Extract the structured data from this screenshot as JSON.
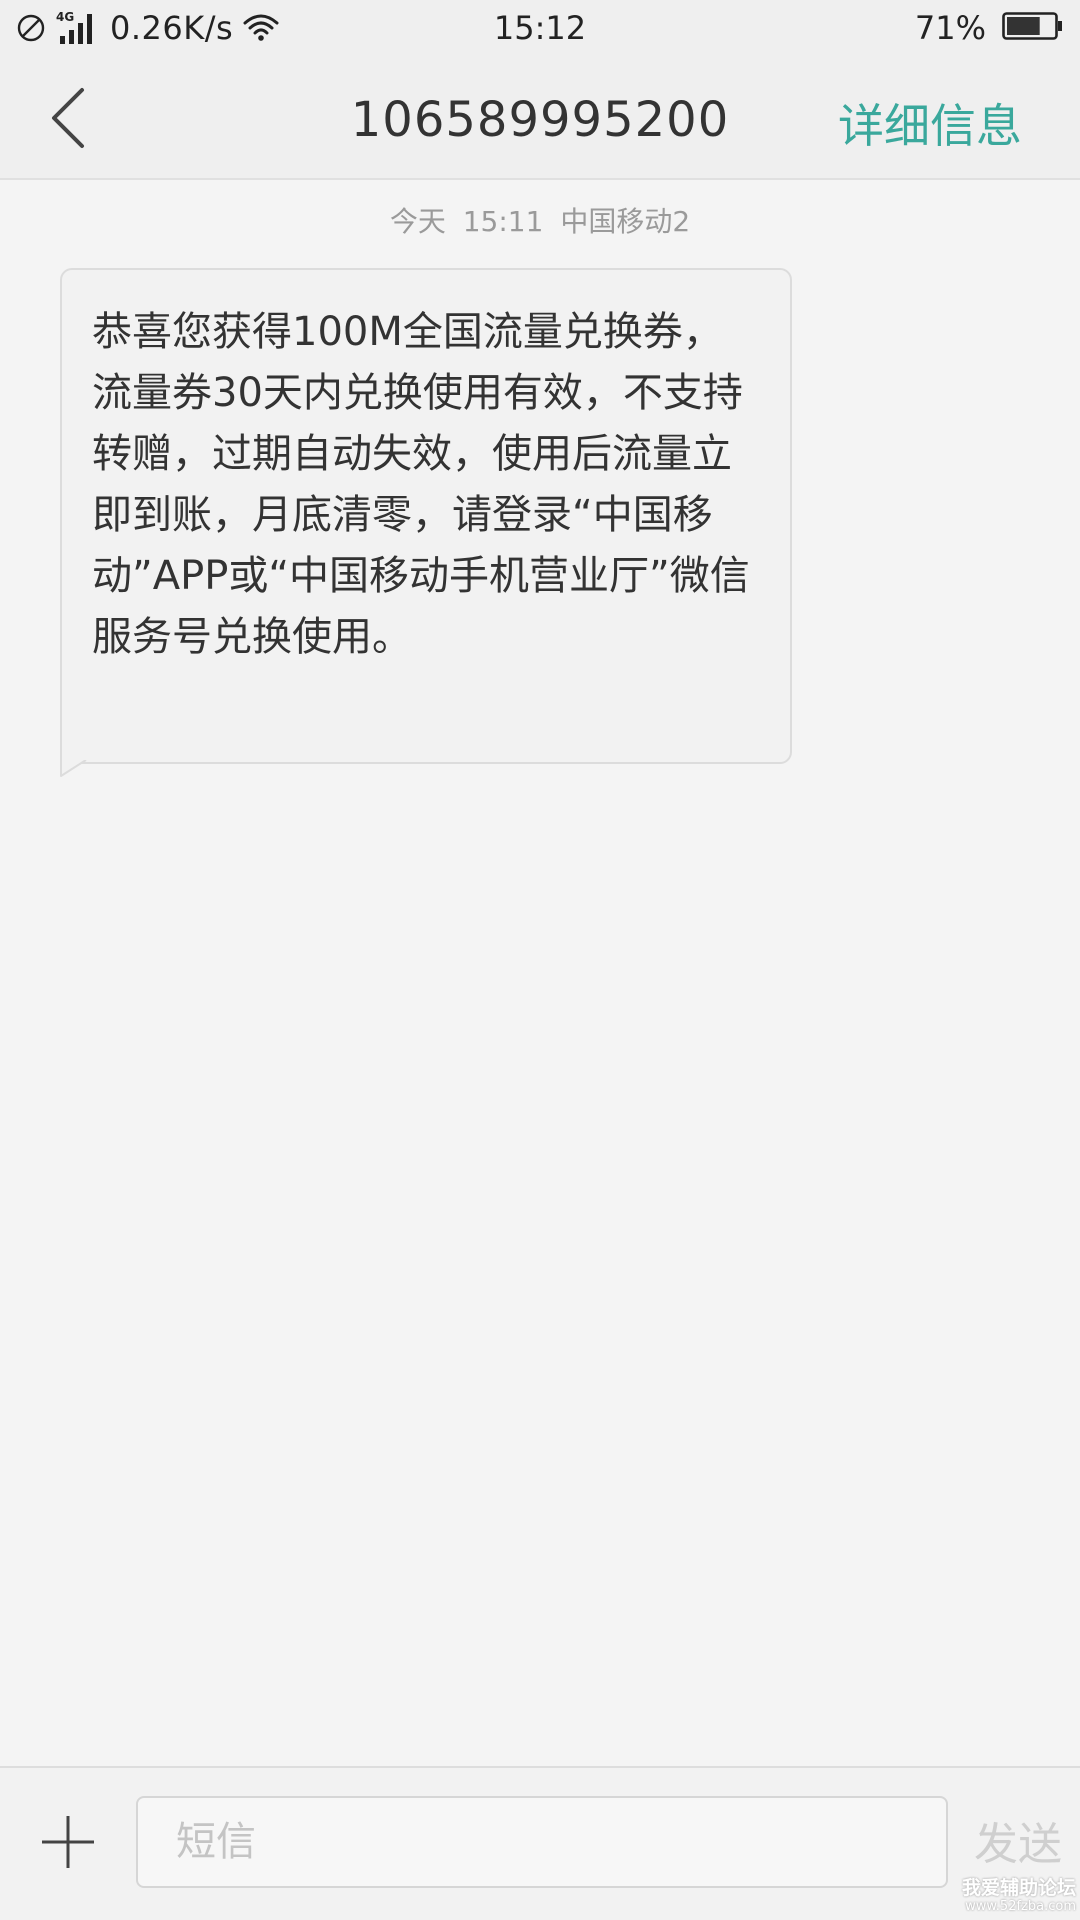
{
  "status_bar": {
    "network_speed": "0.26K/s",
    "network_type": "4G",
    "time": "15:12",
    "battery_percent": "71%",
    "battery_level": 0.71,
    "icons": [
      "do-not-disturb-icon",
      "signal-icon",
      "wifi-icon",
      "battery-icon"
    ]
  },
  "header": {
    "title": "106589995200",
    "details_label": "详细信息",
    "accent_color": "#3aa89c"
  },
  "messages": [
    {
      "meta": "今天 15:11 中国移动2",
      "text": "恭喜您获得100M全国流量兑换券，流量券30天内兑换使用有效，不支持转赠，过期自动失效，使用后流量立即到账，月底清零，请登录“中国移动”APP或“中国移动手机营业厅”微信服务号兑换使用。"
    }
  ],
  "compose": {
    "placeholder": "短信",
    "value": "",
    "send_label": "发送"
  },
  "watermark": {
    "line1": "我爱辅助论坛",
    "line2": "www.52fzba.com"
  }
}
